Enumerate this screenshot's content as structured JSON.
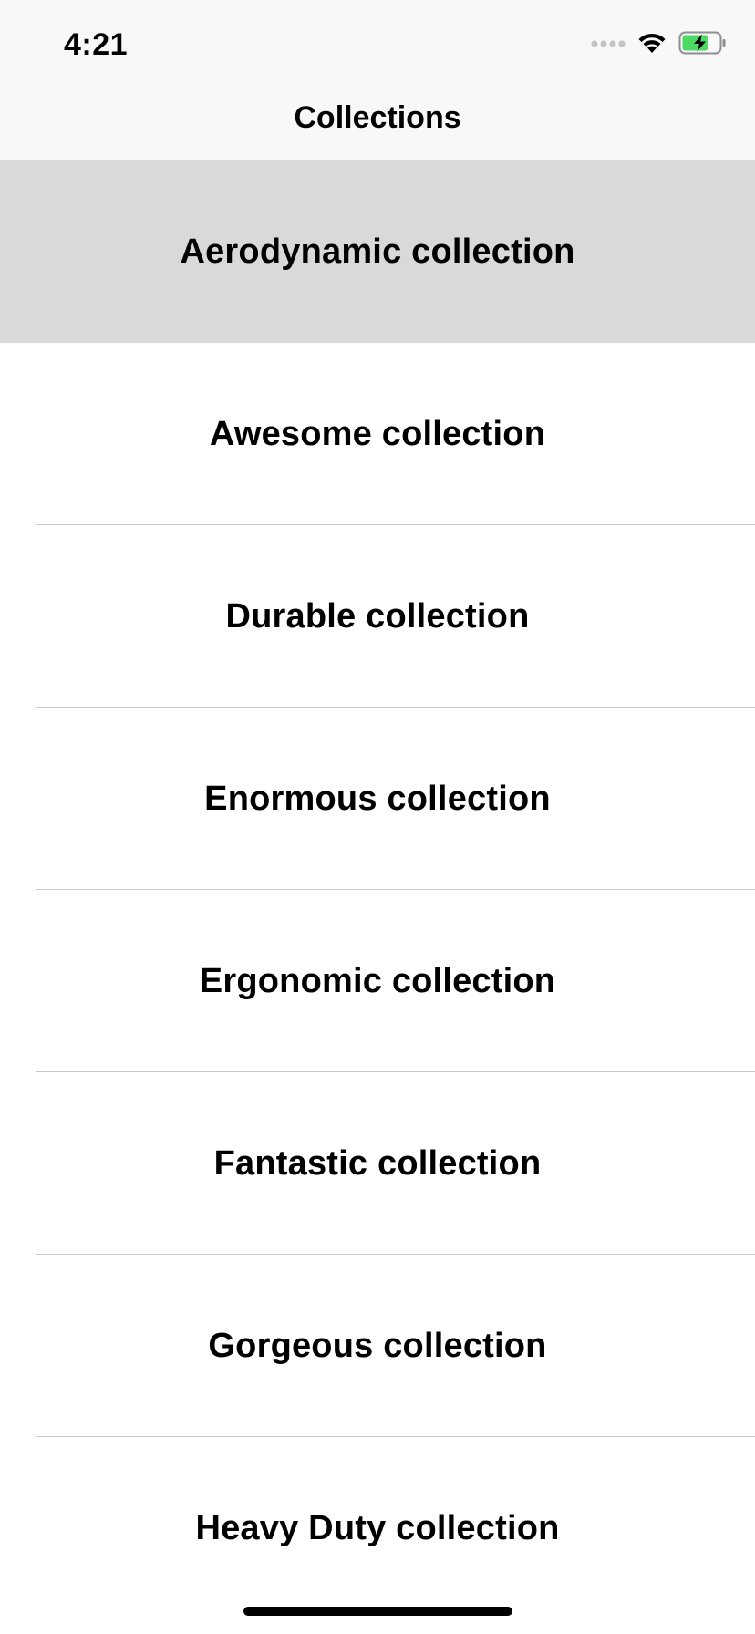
{
  "status_bar": {
    "time": "4:21",
    "icons": [
      "cellular-signal-icon",
      "wifi-icon",
      "battery-charging-icon"
    ]
  },
  "nav_bar": {
    "title": "Collections"
  },
  "collections": [
    {
      "label": "Aerodynamic collection",
      "selected": true
    },
    {
      "label": "Awesome collection",
      "selected": false
    },
    {
      "label": "Durable collection",
      "selected": false
    },
    {
      "label": "Enormous collection",
      "selected": false
    },
    {
      "label": "Ergonomic collection",
      "selected": false
    },
    {
      "label": "Fantastic collection",
      "selected": false
    },
    {
      "label": "Gorgeous collection",
      "selected": false
    },
    {
      "label": "Heavy Duty collection",
      "selected": false
    }
  ],
  "colors": {
    "bar_background": "#f8f8f8",
    "selected_row": "#d9d9d9",
    "separator": "#c8c7cc",
    "battery_fill": "#4cd964"
  }
}
